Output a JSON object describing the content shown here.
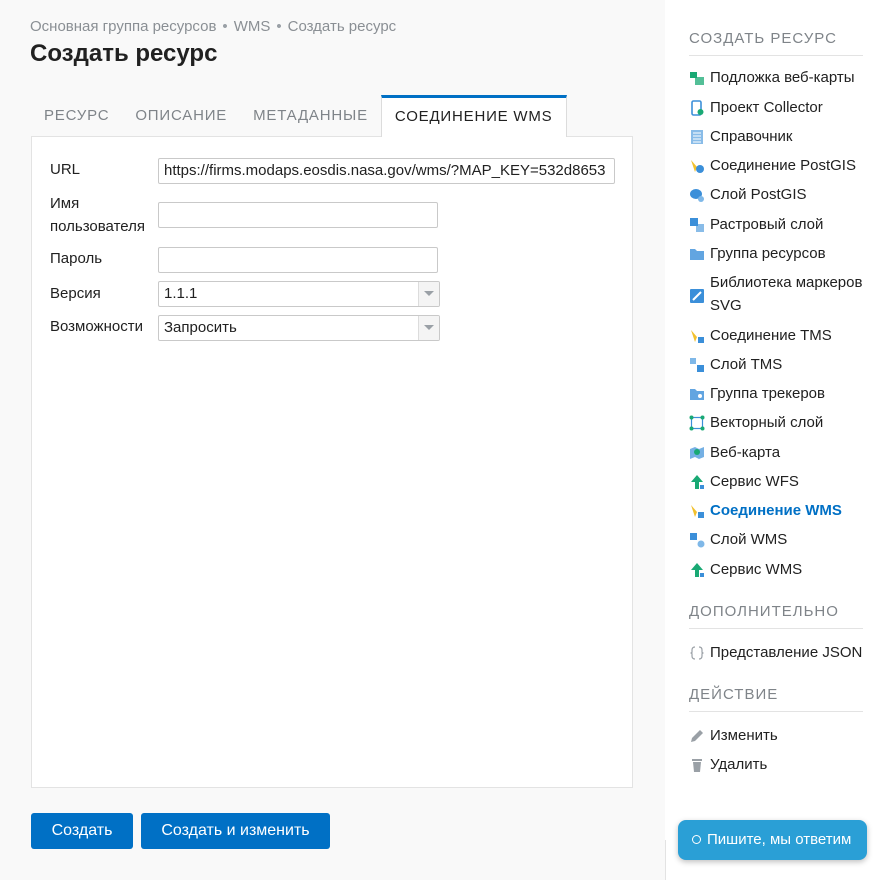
{
  "breadcrumb": [
    "Основная группа ресурсов",
    "WMS",
    "Создать ресурс"
  ],
  "page_title": "Создать ресурс",
  "tabs": [
    "РЕСУРС",
    "ОПИСАНИЕ",
    "МЕТАДАННЫЕ",
    "СОЕДИНЕНИЕ WMS"
  ],
  "active_tab": "СОЕДИНЕНИЕ WMS",
  "form": {
    "url_label": "URL",
    "url_value": "https://firms.modaps.eosdis.nasa.gov/wms/?MAP_KEY=532d8653",
    "username_label": "Имя пользователя",
    "username_value": "",
    "password_label": "Пароль",
    "password_value": "",
    "version_label": "Версия",
    "version_value": "1.1.1",
    "capabilities_label": "Возможности",
    "capabilities_value": "Запросить"
  },
  "buttons": {
    "create": "Создать",
    "create_and_edit": "Создать и изменить"
  },
  "sidebar": {
    "create_title": "СОЗДАТЬ РЕСУРС",
    "create_items": [
      {
        "label": "Подложка веб-карты",
        "icon": "basemap-icon"
      },
      {
        "label": "Проект Collector",
        "icon": "collector-icon"
      },
      {
        "label": "Справочник",
        "icon": "lookup-table-icon"
      },
      {
        "label": "Соединение PostGIS",
        "icon": "postgis-connection-icon"
      },
      {
        "label": "Слой PostGIS",
        "icon": "postgis-layer-icon"
      },
      {
        "label": "Растровый слой",
        "icon": "raster-layer-icon"
      },
      {
        "label": "Группа ресурсов",
        "icon": "folder-icon"
      },
      {
        "label": "Библиотека маркеров SVG",
        "icon": "svg-library-icon"
      },
      {
        "label": "Соединение TMS",
        "icon": "tms-connection-icon"
      },
      {
        "label": "Слой TMS",
        "icon": "tms-layer-icon"
      },
      {
        "label": "Группа трекеров",
        "icon": "tracker-group-icon"
      },
      {
        "label": "Векторный слой",
        "icon": "vector-layer-icon"
      },
      {
        "label": "Веб-карта",
        "icon": "webmap-icon"
      },
      {
        "label": "Сервис WFS",
        "icon": "wfs-service-icon"
      },
      {
        "label": "Соединение WMS",
        "icon": "wms-connection-icon",
        "active": true
      },
      {
        "label": "Слой WMS",
        "icon": "wms-layer-icon"
      },
      {
        "label": "Сервис WMS",
        "icon": "wms-service-icon"
      }
    ],
    "extra_title": "ДОПОЛНИТЕЛЬНО",
    "extra_items": [
      {
        "label": "Представление JSON",
        "icon": "json-braces-icon"
      }
    ],
    "action_title": "ДЕЙСТВИЕ",
    "action_items": [
      {
        "label": "Изменить",
        "icon": "pencil-icon"
      },
      {
        "label": "Удалить",
        "icon": "trash-icon"
      }
    ]
  },
  "chat": {
    "label": "Пишите, мы ответим"
  },
  "colors": {
    "accent": "#0070c5",
    "chat": "#2a9fd6",
    "icon_green": "#19a974",
    "icon_blue": "#3b8fd9",
    "icon_yellow": "#f2c12e"
  }
}
